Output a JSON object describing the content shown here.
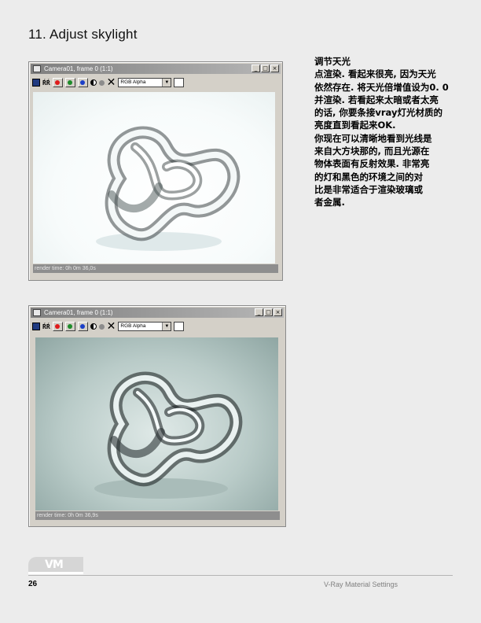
{
  "heading": "11. Adjust skylight",
  "windows": [
    {
      "title": "Camera01, frame 0 (1:1)",
      "channel_select": "RGB Alpha",
      "status": "render time: 0h 0m 36,0s",
      "render_tone": "bright"
    },
    {
      "title": "Camera01, frame 0 (1:1)",
      "channel_select": "RGB Alpha",
      "status": "render time: 0h 0m 36,9s",
      "render_tone": "dim"
    }
  ],
  "toolbar": {
    "clone_label": "ŔŔ",
    "clear_label": "✕",
    "select_arrow": "▼",
    "minimize": "_",
    "maximize": "□",
    "close": "×"
  },
  "colors": {
    "red_channel": "#e01b1b",
    "green_channel": "#1e8c2a",
    "blue_channel": "#1b3fc8"
  },
  "body_text": [
    "调节天光",
    "点渲染. 看起来很亮, 因为天光",
    "依然存在. 将天光倍增值设为0. 0",
    "并渲染. 若看起来太暗或者太亮",
    "的话, 你要条接vray灯光材质的",
    "亮度直到看起来OK.",
    "你现在可以清晰地看到光线是",
    "来自大方块那的, 而且光源在",
    "物体表面有反射效果. 非常亮",
    "的灯和黑色的环境之间的对",
    "比是非常适合于渲染玻璃或",
    "者金属."
  ],
  "footer": {
    "logo_text": "VM",
    "page_number": "26",
    "book_title": "V-Ray Material Settings"
  }
}
